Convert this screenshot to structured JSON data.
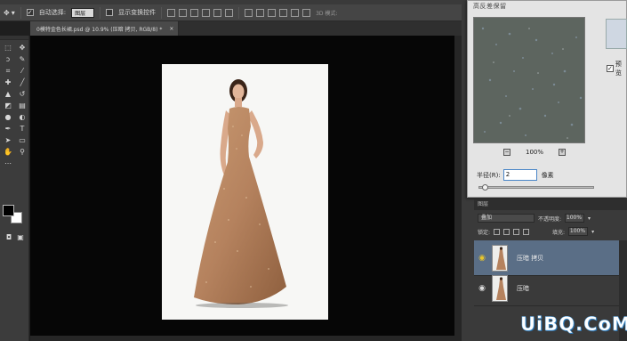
{
  "optionsbar": {
    "auto_select_label": "自动选择:",
    "auto_select_value": "图层",
    "show_transform_label": "显示变换控件",
    "mode3d_label": "3D 模式:"
  },
  "document": {
    "tab_title": "0模特金色长裙.psd @ 10.9% (压暗 拷贝, RGB/8) *",
    "close_glyph": "×"
  },
  "dialog": {
    "title": "高反差保留",
    "zoom_value": "100%",
    "radius_label": "半径(R):",
    "radius_value": "2",
    "radius_unit": "像素",
    "preview_label": "预览"
  },
  "layers_panel": {
    "tab_label": "图层",
    "blend_mode": "叠加",
    "opacity_label": "不透明度:",
    "opacity_value": "100%",
    "lock_label": "锁定:",
    "fill_label": "填充:",
    "fill_value": "100%",
    "layers": [
      {
        "name": "压暗 拷贝",
        "active": true
      },
      {
        "name": "压暗",
        "active": false
      }
    ]
  },
  "watermark": "UiBQ.CoM",
  "colors": {
    "canvas_bg": "#060606",
    "panel_bg": "#3a3a3a",
    "active_layer": "#5a6e86",
    "dress": "#b5825e",
    "watermark_stroke": "#4d9bd8"
  }
}
